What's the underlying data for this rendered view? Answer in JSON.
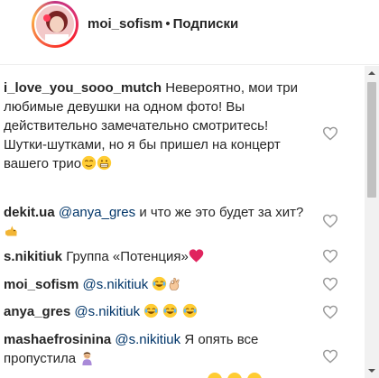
{
  "header": {
    "username": "moi_sofism",
    "separator": "•",
    "follow_label": "Подписки"
  },
  "comments": [
    {
      "user": "i_love_you_sooo_mutch",
      "text": "Невероятно, мои три любимые девушки на одном фото! Вы действительно замечательно смотритесь! Шутки-шутками, но я бы пришел на концерт вашего трио"
    },
    {
      "user": "dekit.ua",
      "mention": "@anya_gres",
      "text": "и что же это будет за хит?"
    },
    {
      "user": "s.nikitiuk",
      "text": "Группа «Потенция»"
    },
    {
      "user": "moi_sofism",
      "mention": "@s.nikitiuk"
    },
    {
      "user": "anya_gres",
      "mention": "@s.nikitiuk"
    },
    {
      "user": "mashaefrosinina",
      "mention": "@s.nikitiuk",
      "text": "Я опять все пропустила"
    }
  ],
  "colors": {
    "text": "#262626",
    "mention": "#003569",
    "divider": "#efefef",
    "heart_emoji": "#e0245e"
  },
  "icons": [
    "avatar",
    "heart-icon",
    "relieved-emoji",
    "grin-emoji",
    "cat-emoji",
    "red-heart-emoji",
    "tears-of-joy-emoji",
    "ok-hand-emoji",
    "woman-facepalm-emoji"
  ]
}
